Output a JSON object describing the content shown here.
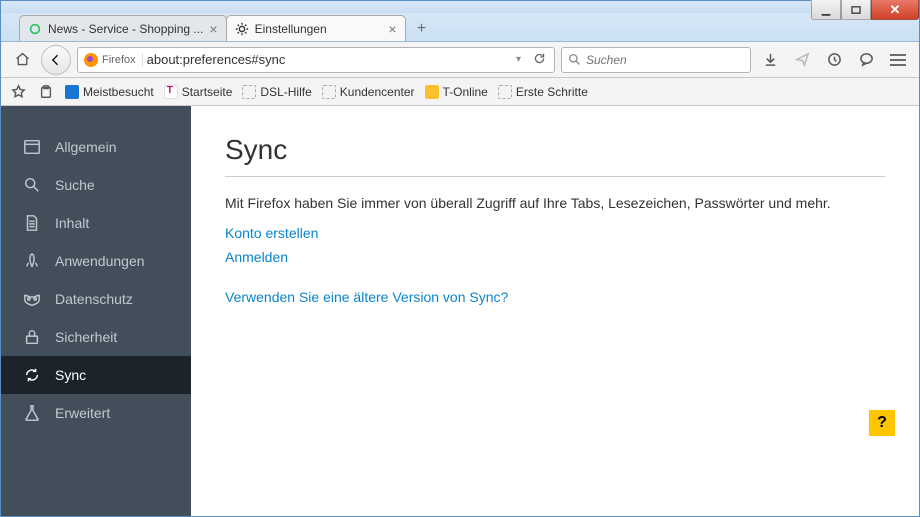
{
  "tabs": [
    {
      "title": "News - Service - Shopping ...",
      "active": false
    },
    {
      "title": "Einstellungen",
      "active": true
    }
  ],
  "urlbar": {
    "identity_label": "Firefox",
    "url": "about:preferences#sync"
  },
  "searchbar": {
    "placeholder": "Suchen"
  },
  "bookmarks": [
    {
      "label": "Meistbesucht",
      "icon": "solid-blue"
    },
    {
      "label": "Startseite",
      "icon": "t-pink"
    },
    {
      "label": "DSL-Hilfe",
      "icon": "dashed"
    },
    {
      "label": "Kundencenter",
      "icon": "dashed"
    },
    {
      "label": "T-Online",
      "icon": "solid-yellow"
    },
    {
      "label": "Erste Schritte",
      "icon": "dashed"
    }
  ],
  "sidebar": {
    "items": [
      {
        "label": "Allgemein"
      },
      {
        "label": "Suche"
      },
      {
        "label": "Inhalt"
      },
      {
        "label": "Anwendungen"
      },
      {
        "label": "Datenschutz"
      },
      {
        "label": "Sicherheit"
      },
      {
        "label": "Sync"
      },
      {
        "label": "Erweitert"
      }
    ]
  },
  "main": {
    "heading": "Sync",
    "description": "Mit Firefox haben Sie immer von überall Zugriff auf Ihre Tabs, Lesezeichen, Passwörter und mehr.",
    "link_create": "Konto erstellen",
    "link_signin": "Anmelden",
    "link_old": "Verwenden Sie eine ältere Version von Sync?"
  },
  "help_label": "?"
}
